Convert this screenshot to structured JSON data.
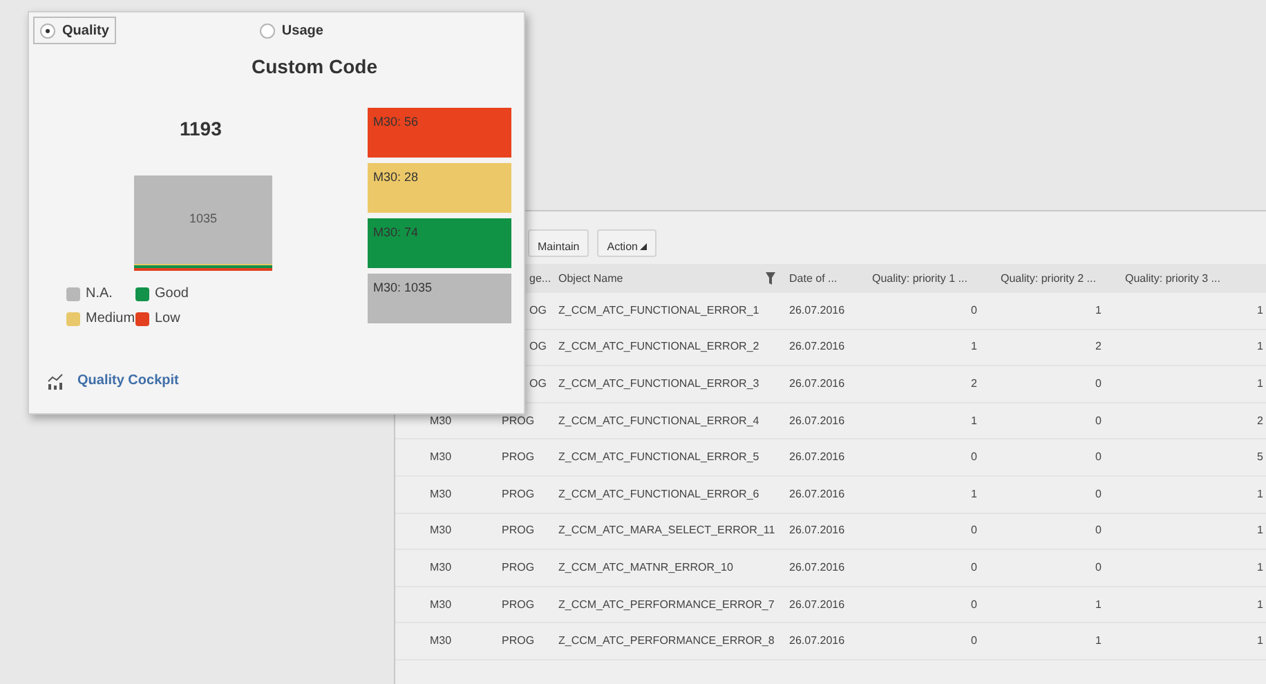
{
  "popup": {
    "modes": [
      {
        "label": "Quality",
        "selected": true
      },
      {
        "label": "Usage",
        "selected": false
      }
    ],
    "title": "Custom Code",
    "total": "1193",
    "bar_label": "1035",
    "legend": [
      {
        "label": "N.A.",
        "color": "#b8b8b8"
      },
      {
        "label": "Good",
        "color": "#12924a"
      },
      {
        "label": "Medium",
        "color": "#e8c86a"
      },
      {
        "label": "Low",
        "color": "#e2401f"
      }
    ],
    "tiles": [
      {
        "label": "M30: 56",
        "color": "#e8421e"
      },
      {
        "label": "M30: 28",
        "color": "#ecc868"
      },
      {
        "label": "M30: 74",
        "color": "#119345"
      },
      {
        "label": "M30: 1035",
        "color": "#b9b9b9"
      }
    ],
    "link": "Quality Cockpit"
  },
  "toolbar": {
    "buttons": [
      {
        "label": "Maintain",
        "menu": false
      },
      {
        "label": "Action",
        "menu": true
      }
    ]
  },
  "table": {
    "columns": [
      "ge...",
      "Object Name",
      "Date of ...",
      "Quality: priority 1 ...",
      "Quality: priority 2 ...",
      "Quality: priority 3 ..."
    ],
    "rows": [
      {
        "type": "OG",
        "name": "Z_CCM_ATC_FUNCTIONAL_ERROR_1",
        "date": "26.07.2016",
        "q1": "0",
        "q2": "1",
        "q3": "1"
      },
      {
        "type": "OG",
        "name": "Z_CCM_ATC_FUNCTIONAL_ERROR_2",
        "date": "26.07.2016",
        "q1": "1",
        "q2": "2",
        "q3": "1"
      },
      {
        "type": "OG",
        "name": "Z_CCM_ATC_FUNCTIONAL_ERROR_3",
        "date": "26.07.2016",
        "q1": "2",
        "q2": "0",
        "q3": "1"
      },
      {
        "system": "M30",
        "type": "PROG",
        "name": "Z_CCM_ATC_FUNCTIONAL_ERROR_4",
        "date": "26.07.2016",
        "q1": "1",
        "q2": "0",
        "q3": "2"
      },
      {
        "system": "M30",
        "type": "PROG",
        "name": "Z_CCM_ATC_FUNCTIONAL_ERROR_5",
        "date": "26.07.2016",
        "q1": "0",
        "q2": "0",
        "q3": "5"
      },
      {
        "system": "M30",
        "type": "PROG",
        "name": "Z_CCM_ATC_FUNCTIONAL_ERROR_6",
        "date": "26.07.2016",
        "q1": "1",
        "q2": "0",
        "q3": "1"
      },
      {
        "system": "M30",
        "type": "PROG",
        "name": "Z_CCM_ATC_MARA_SELECT_ERROR_11",
        "date": "26.07.2016",
        "q1": "0",
        "q2": "0",
        "q3": "1"
      },
      {
        "system": "M30",
        "type": "PROG",
        "name": "Z_CCM_ATC_MATNR_ERROR_10",
        "date": "26.07.2016",
        "q1": "0",
        "q2": "0",
        "q3": "1"
      },
      {
        "system": "M30",
        "type": "PROG",
        "name": "Z_CCM_ATC_PERFORMANCE_ERROR_7",
        "date": "26.07.2016",
        "q1": "0",
        "q2": "1",
        "q3": "1"
      },
      {
        "system": "M30",
        "type": "PROG",
        "name": "Z_CCM_ATC_PERFORMANCE_ERROR_8",
        "date": "26.07.2016",
        "q1": "0",
        "q2": "1",
        "q3": "1"
      }
    ]
  }
}
